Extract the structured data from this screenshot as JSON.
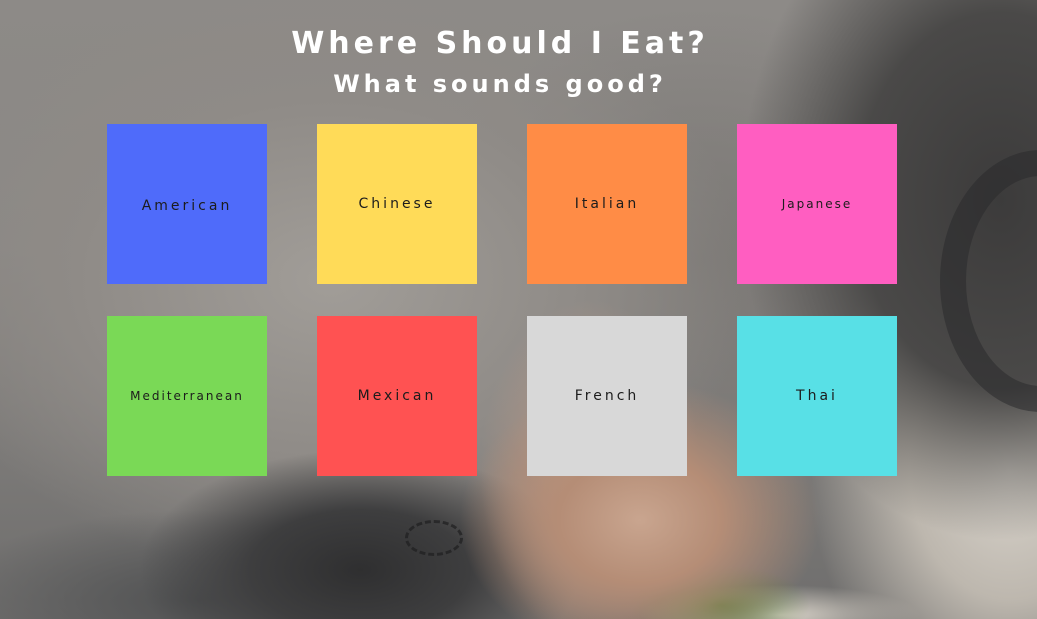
{
  "header": {
    "title": "Where Should I Eat?",
    "subtitle": "What sounds good?"
  },
  "cuisines": [
    {
      "label": "American",
      "color": "#4f6bfa"
    },
    {
      "label": "Chinese",
      "color": "#ffdb58"
    },
    {
      "label": "Italian",
      "color": "#ff8c46"
    },
    {
      "label": "Japanese",
      "color": "#ff5ec1"
    },
    {
      "label": "Mediterranean",
      "color": "#7ad956"
    },
    {
      "label": "Mexican",
      "color": "#ff5252"
    },
    {
      "label": "French",
      "color": "#d8d8d8"
    },
    {
      "label": "Thai",
      "color": "#58e0e6"
    }
  ]
}
